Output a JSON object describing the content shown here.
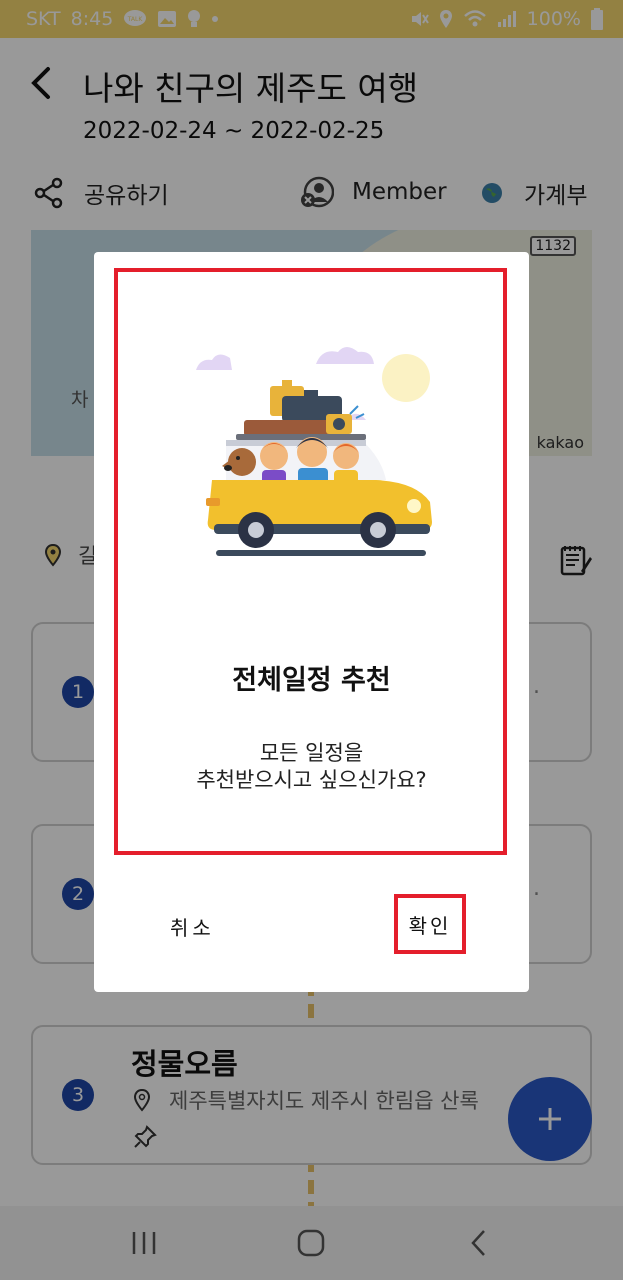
{
  "status_bar": {
    "carrier": "SKT",
    "time": "8:45",
    "talk_label": "TALK",
    "battery": "100%"
  },
  "header": {
    "title": "나와 친구의 제주도 여행",
    "dates": "2022-02-24 ~ 2022-02-25"
  },
  "actions": {
    "share_label": "공유하기",
    "member_label": "Member",
    "budget_label": "가계부"
  },
  "map": {
    "road_badge": "1132",
    "place_label": "차",
    "attribution": "kakao"
  },
  "location_row": {
    "text": "길"
  },
  "itinerary": [
    {
      "number": "1",
      "more": "..",
      "title": "",
      "address": ""
    },
    {
      "number": "2",
      "more": "..",
      "title": "",
      "address": ""
    },
    {
      "number": "3",
      "more": "",
      "title": "정물오름",
      "address": "제주특별자치도 제주시 한림읍 산록"
    }
  ],
  "dialog": {
    "title": "전체일정 추천",
    "message_line1": "모든 일정을",
    "message_line2": "추천받으시고 싶으신가요?",
    "cancel_label": "취소",
    "confirm_label": "확인"
  },
  "colors": {
    "status_bar": "#f5d76e",
    "accent_blue": "#1f47a7",
    "fab_blue": "#2a59c6",
    "highlight_red": "#e41e2b"
  }
}
